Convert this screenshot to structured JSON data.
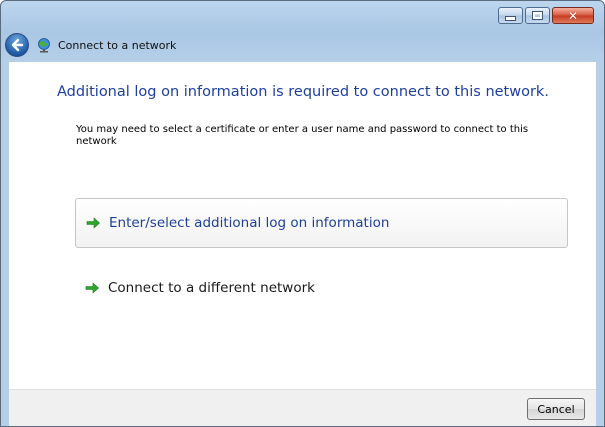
{
  "window": {
    "title": "Connect to a network",
    "caption_buttons": [
      "minimize",
      "maximize",
      "close"
    ],
    "accent_color": "#1e3f9b"
  },
  "content": {
    "heading": "Additional log on information is required to connect to this network.",
    "description": "You may need to select a certificate or enter a user name and password to connect to this network"
  },
  "commands": [
    {
      "label": "Enter/select additional log on information",
      "icon": "green-arrow-icon"
    },
    {
      "label": "Connect to a different network",
      "icon": "green-arrow-icon"
    }
  ],
  "footer": {
    "cancel_label": "Cancel"
  }
}
